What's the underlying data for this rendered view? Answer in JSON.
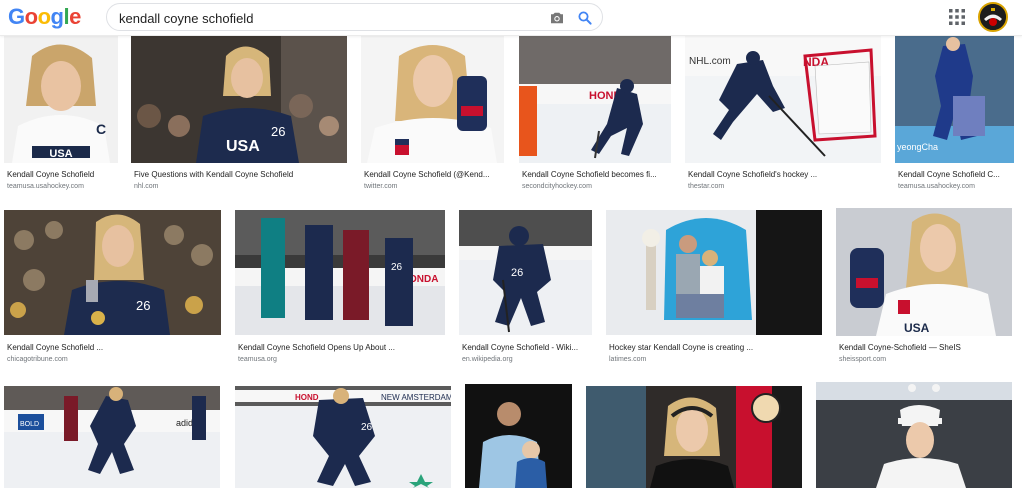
{
  "header": {
    "logo": [
      "G",
      "o",
      "o",
      "g",
      "l",
      "e"
    ],
    "logo_colors": [
      "#4285f4",
      "#ea4335",
      "#fbbc05",
      "#4285f4",
      "#34a853",
      "#ea4335"
    ],
    "search_value": "kendall coyne schofield",
    "camera_icon": "camera-icon",
    "search_icon": "search-icon",
    "apps_icon": "apps-grid-icon"
  },
  "results": [
    {
      "caption": "Kendall Coyne Schofield",
      "source": "teamusa.usahockey.com"
    },
    {
      "caption": "Five Questions with Kendall Coyne Schofield",
      "source": "nhl.com"
    },
    {
      "caption": "Kendall Coyne Schofield (@Kend...",
      "source": "twitter.com"
    },
    {
      "caption": "Kendall Coyne Schofield becomes fi...",
      "source": "secondcityhockey.com"
    },
    {
      "caption": "Kendall Coyne Schofield's hockey ...",
      "source": "thestar.com"
    },
    {
      "caption": "Kendall Coyne Schofield C...",
      "source": "teamusa.usahockey.com"
    },
    {
      "caption": "Kendall Coyne Schofield ...",
      "source": "chicagotribune.com"
    },
    {
      "caption": "Kendall Coyne Schofield Opens Up About ...",
      "source": "teamusa.org"
    },
    {
      "caption": "Kendall Coyne Schofield - Wiki...",
      "source": "en.wikipedia.org"
    },
    {
      "caption": "Hockey star Kendall Coyne is creating ...",
      "source": "latimes.com"
    },
    {
      "caption": "Kendall Coyne-Schofield — SheIS",
      "source": "sheissport.com"
    },
    {
      "caption": "",
      "source": ""
    },
    {
      "caption": "",
      "source": ""
    },
    {
      "caption": "",
      "source": ""
    },
    {
      "caption": "",
      "source": ""
    },
    {
      "caption": "",
      "source": ""
    }
  ]
}
